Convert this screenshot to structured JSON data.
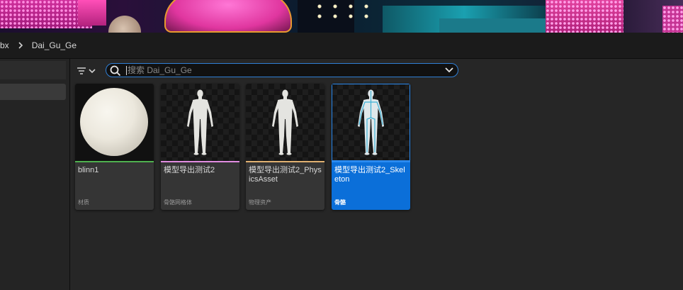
{
  "breadcrumb": {
    "segments": [
      "bx",
      "Dai_Gu_Ge"
    ]
  },
  "search": {
    "placeholder": "搜索 Dai_Gu_Ge",
    "value": ""
  },
  "assets": [
    {
      "name": "blinn1",
      "type": "材质",
      "type_color": "#4fb04f",
      "thumbnail": "sphere-icon",
      "selected": false
    },
    {
      "name": "模型导出测试2",
      "type": "骨骼网格体",
      "type_color": "#e08ce0",
      "thumbnail": "mannequin-icon",
      "selected": false
    },
    {
      "name": "模型导出测试2_PhysicsAsset",
      "type": "物理资产",
      "type_color": "#e0b070",
      "thumbnail": "mannequin-icon",
      "selected": false
    },
    {
      "name": "模型导出测试2_Skeleton",
      "type": "骨骼",
      "type_color": "#2a8af0",
      "thumbnail": "skeleton-icon",
      "selected": true
    }
  ],
  "colors": {
    "accent": "#0b6fd9",
    "search_border": "#2f7fd6"
  }
}
